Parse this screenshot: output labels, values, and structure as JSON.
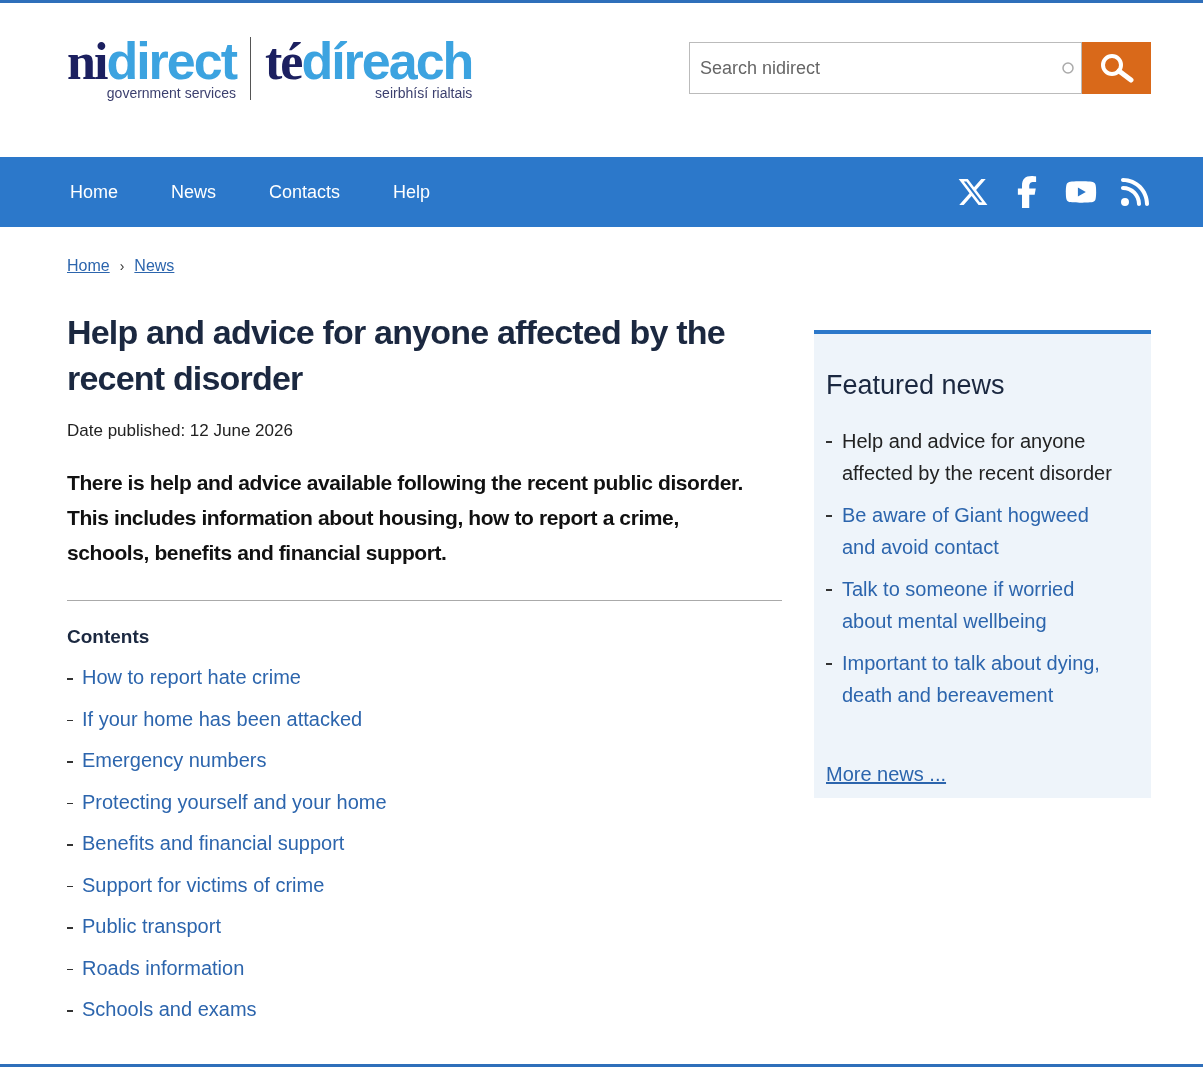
{
  "logo": {
    "en_dark": "ni",
    "en_light": "direct",
    "en_sub": "government services",
    "ga_dark": "té",
    "ga_light": "díreach",
    "ga_sub": "seirbhísí rialtais"
  },
  "search": {
    "placeholder": "Search nidirect"
  },
  "nav": [
    {
      "label": "Home"
    },
    {
      "label": "News"
    },
    {
      "label": "Contacts"
    },
    {
      "label": "Help"
    }
  ],
  "social": [
    {
      "kind": "x"
    },
    {
      "kind": "facebook"
    },
    {
      "kind": "youtube"
    },
    {
      "kind": "rss"
    }
  ],
  "breadcrumb": [
    "Home",
    "News"
  ],
  "breadcrumb_separator": "›",
  "article": {
    "title": "Help and advice for anyone affected by the recent disorder",
    "date": "Date published: 12 June 2026",
    "summary": "There is help and advice available following the recent public disorder. This includes information about housing, how to report a crime, schools, benefits and financial support.",
    "contents_heading": "Contents",
    "contents": [
      "How to report hate crime",
      "If your home has been attacked",
      "Emergency numbers",
      "Protecting yourself and your home",
      "Benefits and financial support",
      "Support for victims of crime",
      "Public transport",
      "Roads information",
      "Schools and exams"
    ]
  },
  "featured": {
    "heading": "Featured news",
    "items": [
      {
        "label": "Help and advice for anyone affected by the recent disorder",
        "selected": true
      },
      {
        "label": "Be aware of Giant hogweed and avoid contact",
        "selected": false
      },
      {
        "label": "Talk to someone if worried about mental wellbeing",
        "selected": false
      },
      {
        "label": "Important to talk about dying, death and bereavement",
        "selected": false
      }
    ],
    "more": "More news ..."
  }
}
